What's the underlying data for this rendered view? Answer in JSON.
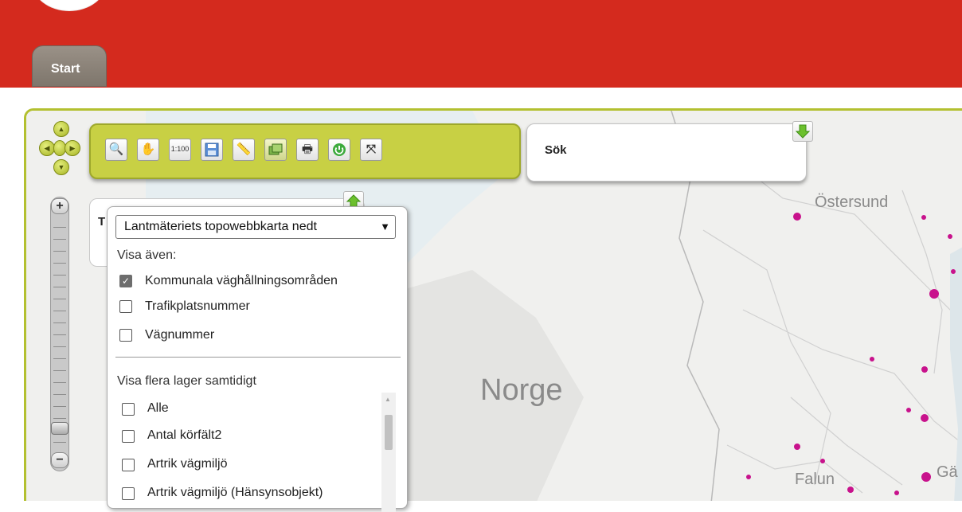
{
  "tabs": [
    {
      "label": "Start"
    }
  ],
  "map": {
    "places": [
      {
        "name": "Östersund"
      },
      {
        "name": "Norge"
      },
      {
        "name": "Falun"
      },
      {
        "name": "Gä"
      }
    ]
  },
  "search": {
    "label": "Sök"
  },
  "layer_panel": {
    "label": "T"
  },
  "toolbar": {
    "tools": [
      "zoom-in-tool",
      "pan-tool",
      "scale-tool",
      "save-tool",
      "measure-tool",
      "layers-tool",
      "print-tool",
      "power-tool",
      "fullscreen-tool"
    ]
  },
  "zoom": {
    "plus": "+",
    "minus": "−"
  },
  "dropdown": {
    "selected": "Lantmäteriets topowebbkarta nedt",
    "visa_aven": "Visa även:",
    "checkboxes": [
      {
        "label": "Kommunala väghållningsområden",
        "checked": true
      },
      {
        "label": "Trafikplatsnummer",
        "checked": false
      },
      {
        "label": "Vägnummer",
        "checked": false
      }
    ],
    "multi_label": "Visa flera lager samtidigt",
    "layers": [
      {
        "label": "Alle",
        "checked": false
      },
      {
        "label": "Antal körfält2",
        "checked": false
      },
      {
        "label": "Artrik vägmiljö",
        "checked": false
      },
      {
        "label": "Artrik vägmiljö (Hänsynsobjekt)",
        "checked": false
      }
    ]
  },
  "colors": {
    "header": "#d42a1e",
    "frame": "#b3c030",
    "toolbar": "#c8d044",
    "route_markers": "#c8128c"
  }
}
